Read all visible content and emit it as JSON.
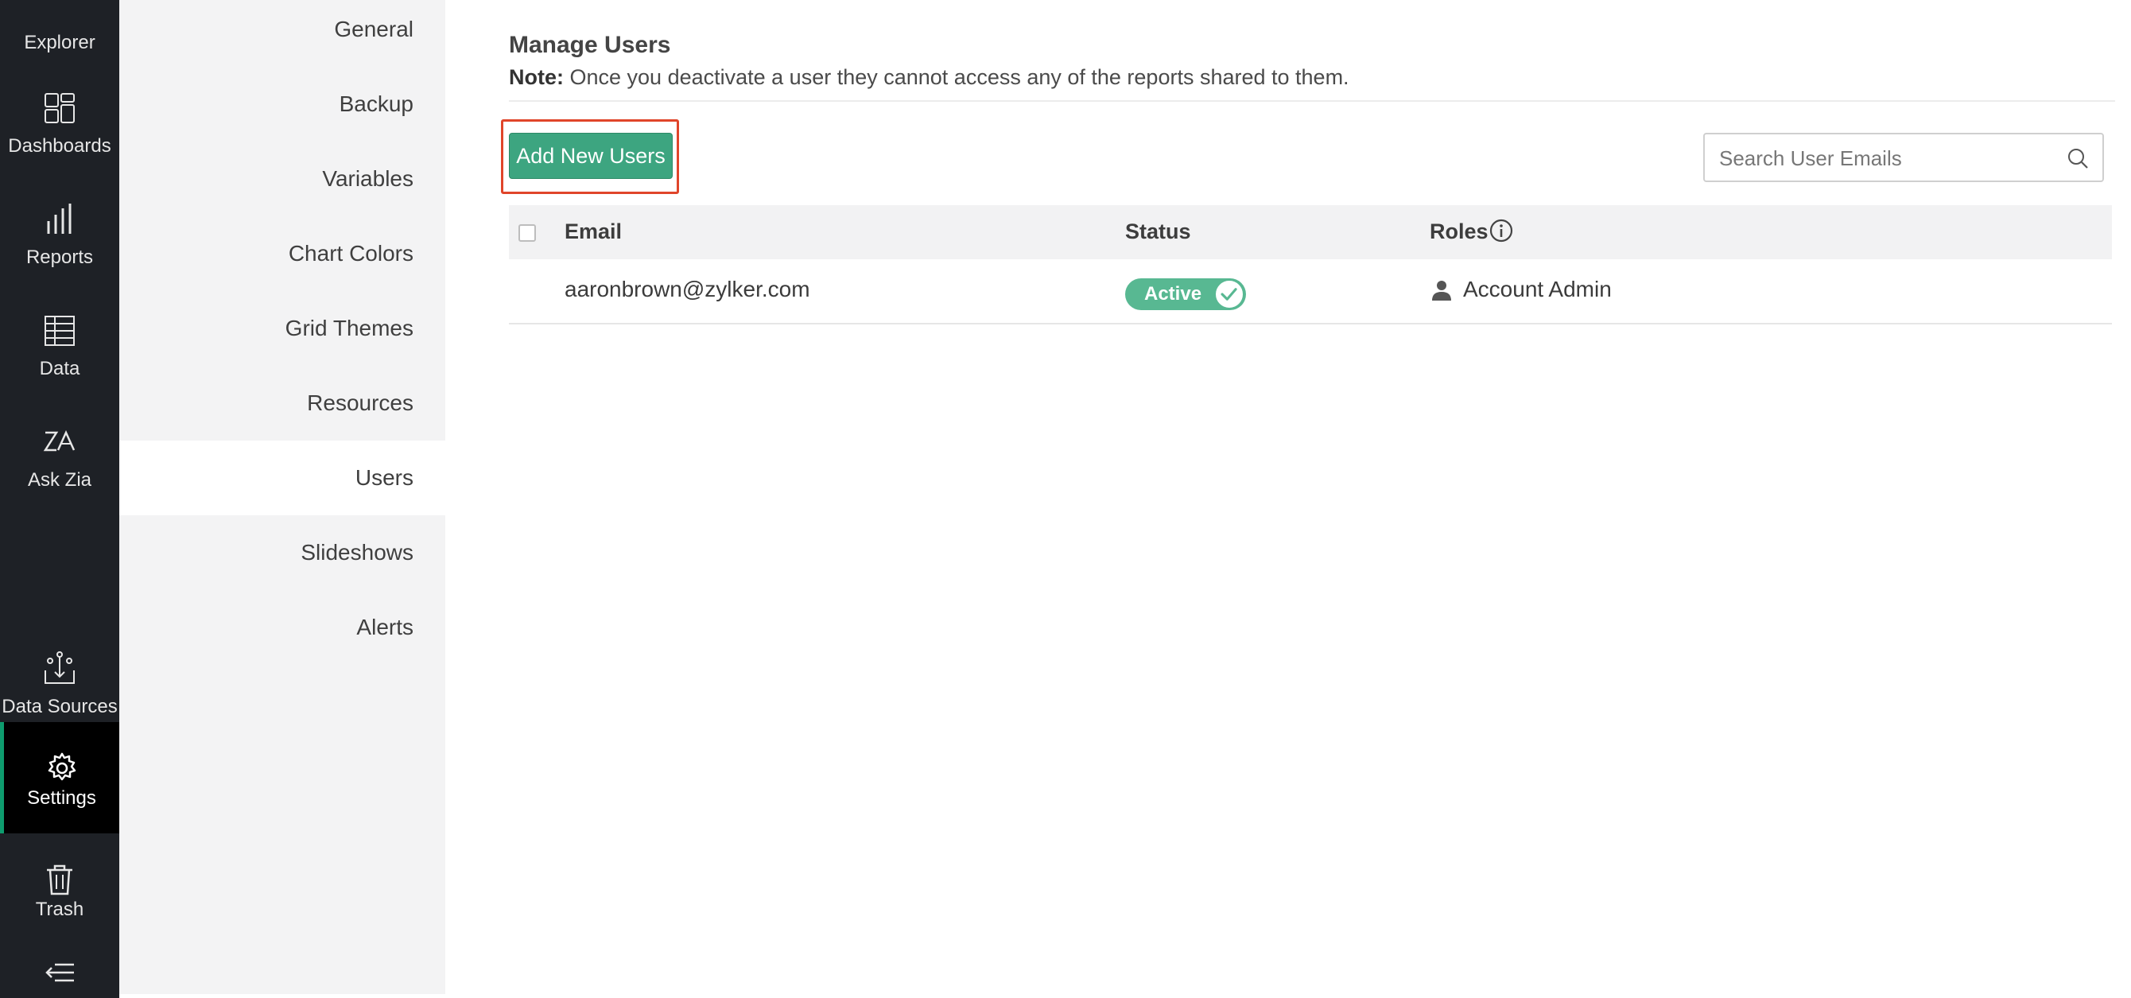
{
  "rail": {
    "explorer": "Explorer",
    "dashboards": "Dashboards",
    "reports": "Reports",
    "data": "Data",
    "ask_zia": "Ask Zia",
    "data_sources": "Data Sources",
    "settings": "Settings",
    "trash": "Trash"
  },
  "settings_nav": {
    "items": [
      "General",
      "Backup",
      "Variables",
      "Chart Colors",
      "Grid Themes",
      "Resources",
      "Users",
      "Slideshows",
      "Alerts"
    ],
    "active": "Users"
  },
  "manage_users": {
    "title": "Manage Users",
    "note_label": "Note:",
    "note_text": " Once you deactivate a user they cannot access any of the reports shared to them.",
    "add_button": "Add New Users",
    "search_placeholder": "Search User Emails"
  },
  "table": {
    "headers": {
      "email": "Email",
      "status": "Status",
      "roles": "Roles"
    },
    "rows": [
      {
        "email": "aaronbrown@zylker.com",
        "status": "Active",
        "role": "Account Admin"
      }
    ]
  },
  "colors": {
    "accent": "#3da580",
    "status_active": "#58b892",
    "highlight": "#e0452a",
    "rail_bg": "#1e2126"
  }
}
